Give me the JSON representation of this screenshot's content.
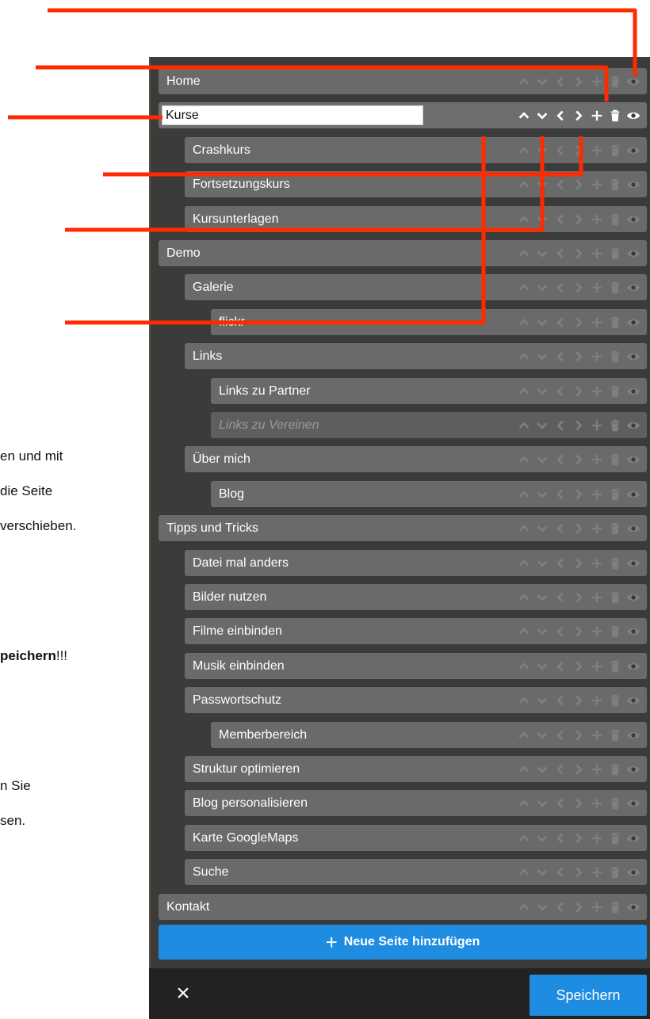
{
  "background_text": {
    "line1": "en und mit",
    "line2": " die Seite",
    "line3": "verschieben.",
    "line4_bold": "peichern",
    "line4_rest": "!!!",
    "line5": "n Sie",
    "line6": "sen."
  },
  "pages": [
    {
      "label": "Home",
      "level": 0
    },
    {
      "label": "Kurse",
      "level": 0,
      "editing": true
    },
    {
      "label": "Crashkurs",
      "level": 1
    },
    {
      "label": "Fortsetzungskurs",
      "level": 1
    },
    {
      "label": "Kursunterlagen",
      "level": 1
    },
    {
      "label": "Demo",
      "level": 0
    },
    {
      "label": "Galerie",
      "level": 1
    },
    {
      "label": "flickr",
      "level": 2
    },
    {
      "label": "Links",
      "level": 1
    },
    {
      "label": "Links zu Partner",
      "level": 2
    },
    {
      "label": "Links zu Vereinen",
      "level": 2,
      "hidden": true
    },
    {
      "label": "Über mich",
      "level": 1
    },
    {
      "label": "Blog",
      "level": 2
    },
    {
      "label": "Tipps und Tricks",
      "level": 0
    },
    {
      "label": "Datei mal anders",
      "level": 1
    },
    {
      "label": "Bilder nutzen",
      "level": 1
    },
    {
      "label": "Filme einbinden",
      "level": 1
    },
    {
      "label": "Musik einbinden",
      "level": 1
    },
    {
      "label": "Passwortschutz",
      "level": 1
    },
    {
      "label": "Memberbereich",
      "level": 2
    },
    {
      "label": "Struktur optimieren",
      "level": 1
    },
    {
      "label": "Blog personalisieren",
      "level": 1
    },
    {
      "label": "Karte GoogleMaps",
      "level": 1
    },
    {
      "label": "Suche",
      "level": 1
    },
    {
      "label": "Kontakt",
      "level": 0
    }
  ],
  "controls": [
    "chevron-up-icon",
    "chevron-down-icon",
    "chevron-left-icon",
    "chevron-right-icon",
    "plus-icon",
    "trash-icon",
    "eye-icon"
  ],
  "add_page_label": "Neue Seite hinzufügen",
  "close_label": "×",
  "save_label": "Speichern",
  "colors": {
    "panel": "#3b3b3b",
    "row": "#6a6a6a",
    "accent": "#1e8ce0",
    "callout": "#ff2a00"
  }
}
